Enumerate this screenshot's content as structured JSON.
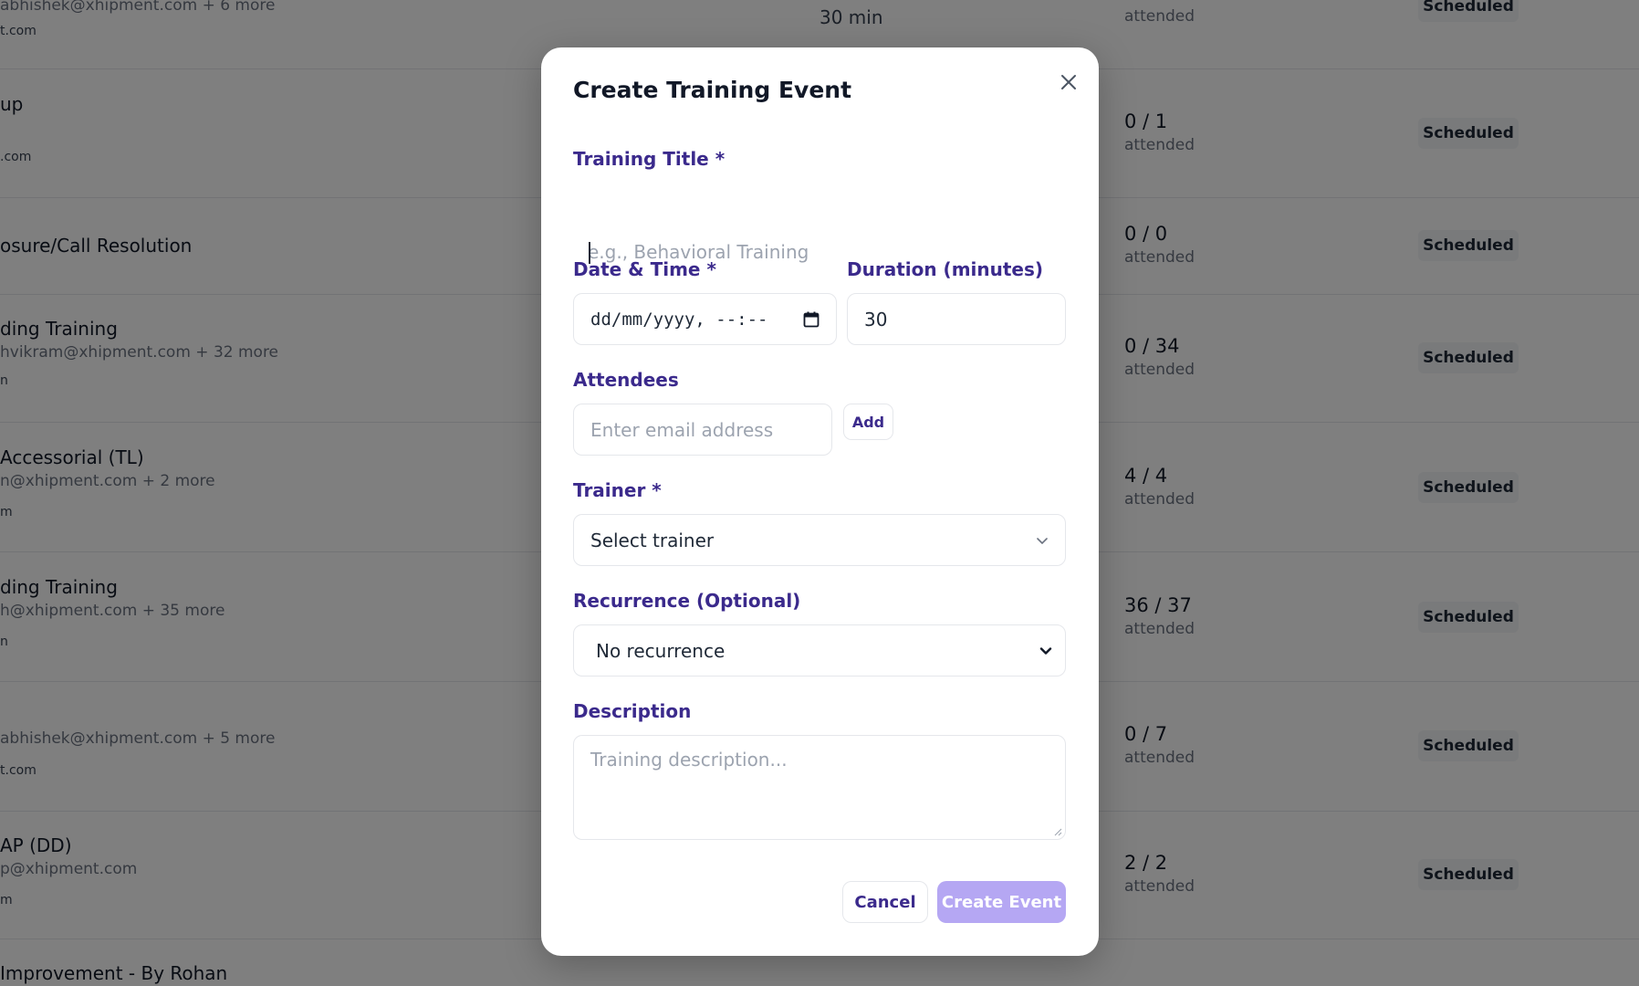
{
  "background": {
    "rows": [
      {
        "title": "",
        "emails": "abhishek@xhipment.com + 6 more",
        "small": "t.com",
        "duration": "30 min",
        "count": "",
        "attended": "attended",
        "status": "Scheduled"
      },
      {
        "title": "up",
        "emails": "",
        "small": ".com",
        "duration": "",
        "count": "0 / 1",
        "attended": "attended",
        "status": "Scheduled"
      },
      {
        "title": "osure/Call Resolution",
        "emails": "",
        "small": "",
        "duration": "",
        "count": "0 / 0",
        "attended": "attended",
        "status": "Scheduled"
      },
      {
        "title": "ding Training",
        "emails": "hvikram@xhipment.com + 32 more",
        "small": "n",
        "duration": "",
        "count": "0 / 34",
        "attended": "attended",
        "status": "Scheduled"
      },
      {
        "title": "Accessorial (TL)",
        "emails": "n@xhipment.com + 2 more",
        "small": "m",
        "duration": "",
        "count": "4 / 4",
        "attended": "attended",
        "status": "Scheduled"
      },
      {
        "title": "ding Training",
        "emails": "h@xhipment.com + 35 more",
        "small": "n",
        "duration": "",
        "count": "36 / 37",
        "attended": "attended",
        "status": "Scheduled"
      },
      {
        "title": "",
        "emails": "abhishek@xhipment.com + 5 more",
        "small": "t.com",
        "duration": "",
        "count": "0 / 7",
        "attended": "attended",
        "status": "Scheduled"
      },
      {
        "title": "AP (DD)",
        "emails": "p@xhipment.com",
        "small": "m",
        "duration": "",
        "count": "2 / 2",
        "attended": "attended",
        "status": "Scheduled"
      },
      {
        "title": "Improvement - By Rohan",
        "emails": "",
        "small": "",
        "duration": "",
        "count": "",
        "attended": "",
        "status": ""
      }
    ]
  },
  "modal": {
    "title": "Create Training Event",
    "close_icon": "close-icon",
    "training_title_label": "Training Title *",
    "training_title_placeholder": "e.g., Behavioral Training",
    "datetime_label": "Date & Time *",
    "datetime_value": "dd/mm/yyyy, --:--",
    "calendar_icon": "calendar-icon",
    "duration_label": "Duration (minutes)",
    "duration_value": "30",
    "attendees_label": "Attendees",
    "attendees_placeholder": "Enter email address",
    "add_label": "Add",
    "trainer_label": "Trainer *",
    "trainer_value": "Select trainer",
    "recurrence_label": "Recurrence (Optional)",
    "recurrence_value": "No recurrence",
    "description_label": "Description",
    "description_placeholder": "Training description...",
    "cancel_label": "Cancel",
    "create_label": "Create Event",
    "colors": {
      "accent": "#3b2a8c",
      "primary_button": "#b5a7f3"
    }
  }
}
